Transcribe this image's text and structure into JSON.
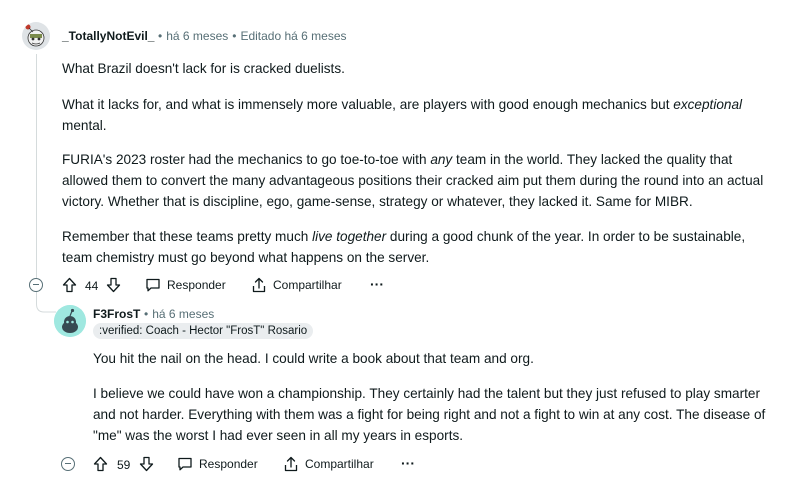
{
  "comment1": {
    "username": "_TotallyNotEvil_",
    "time": "há 6 meses",
    "edited": "Editado há 6 meses",
    "paragraphs": {
      "p1": "What Brazil doesn't lack for is cracked duelists.",
      "p2a": "What it lacks for, and what is immensely more valuable, are players with good enough mechanics but ",
      "p2em": "exceptional",
      "p2b": " mental.",
      "p3a": "FURIA's 2023 roster had the mechanics to go toe-to-toe with ",
      "p3em": "any",
      "p3b": " team in the world. They lacked the quality that allowed them to convert the many advantageous positions their cracked aim put them during the round into an actual victory. Whether that is discipline, ego, game-sense, strategy or whatever, they lacked it. Same for MIBR.",
      "p4a": "Remember that these teams pretty much ",
      "p4em": "live together",
      "p4b": " during a good chunk of the year. In order to be sustainable, team chemistry must go beyond what happens on the server."
    },
    "actions": {
      "votes": "44",
      "reply": "Responder",
      "share": "Compartilhar",
      "more": "···"
    }
  },
  "comment2": {
    "username": "F3FrosT",
    "time": "há 6 meses",
    "flair": ":verified: Coach - Hector \"FrosT\" Rosario",
    "paragraphs": {
      "p1": "You hit the nail on the head. I could write a book about that team and org.",
      "p2": "I believe we could have won a championship. They certainly had the talent but they just refused to play smarter and not harder. Everything with them was a fight for being right and not a fight to win at any cost. The disease of \"me\" was the worst I had ever seen in all my years in esports."
    },
    "actions": {
      "votes": "59",
      "reply": "Responder",
      "share": "Compartilhar",
      "more": "···"
    }
  },
  "icons": {
    "upvote": "upvote-arrow-icon",
    "downvote": "downvote-arrow-icon",
    "reply": "speech-bubble-icon",
    "share": "share-upload-icon",
    "collapse": "collapse-minus-icon"
  },
  "colors": {
    "text": "#0f1a1c",
    "meta": "#576f76",
    "thread": "#d5dbdc",
    "flair_bg": "#eaedef",
    "avatar2_bg": "#9fe8e0"
  }
}
